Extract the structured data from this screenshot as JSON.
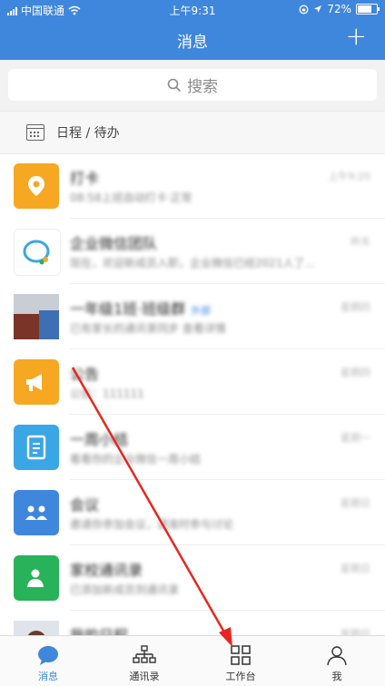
{
  "status_bar": {
    "carrier": "中国联通",
    "time": "上午9:31",
    "battery": "72%"
  },
  "header": {
    "title": "消息"
  },
  "search": {
    "placeholder": "搜索"
  },
  "schedule": {
    "label": "日程 / 待办"
  },
  "messages": [
    {
      "name": "打卡",
      "preview": "08:58上班自动打卡·正常",
      "time": "上午9:20",
      "color": "#f7a822",
      "icon": "location-pin-icon"
    },
    {
      "name": "企业微信团队",
      "preview": "现在，欢迎新成员入职，企业微信已经2021人了...",
      "time": "昨天",
      "color": "#ffffff",
      "icon": "chat-bubble-icon"
    },
    {
      "name": "一年级1班·班级群",
      "tag": "外部",
      "preview": "已有家长的通讯录同步 查看详情",
      "time": "星期四",
      "color": "#8a4a3a",
      "icon": "group-photo-icon"
    },
    {
      "name": "公告",
      "preview": "公告：111111",
      "time": "星期四",
      "color": "#f7a822",
      "icon": "megaphone-icon"
    },
    {
      "name": "一周小结",
      "preview": "看看你的企业微信一周小结",
      "time": "星期一",
      "color": "#3ba6e6",
      "icon": "report-icon"
    },
    {
      "name": "会议",
      "preview": "邀请你参加会议，请准时参与讨论",
      "time": "星期日",
      "color": "#3f86dd",
      "icon": "meeting-icon"
    },
    {
      "name": "家校通讯录",
      "preview": "已添加新成员到通讯录",
      "time": "星期日",
      "color": "#28b35a",
      "icon": "contact-card-icon"
    },
    {
      "name": "我的日程",
      "preview": "",
      "time": "星期日",
      "color": "#cfd6de",
      "icon": "avatar-photo-icon"
    }
  ],
  "tabs": [
    {
      "label": "消息",
      "icon": "chat-bubble-icon",
      "active": true
    },
    {
      "label": "通讯录",
      "icon": "org-chart-icon",
      "active": false
    },
    {
      "label": "工作台",
      "icon": "grid-icon",
      "active": false
    },
    {
      "label": "我",
      "icon": "person-icon",
      "active": false
    }
  ],
  "colors": {
    "brand": "#3f86dd",
    "annotation_arrow": "#e8261f"
  }
}
